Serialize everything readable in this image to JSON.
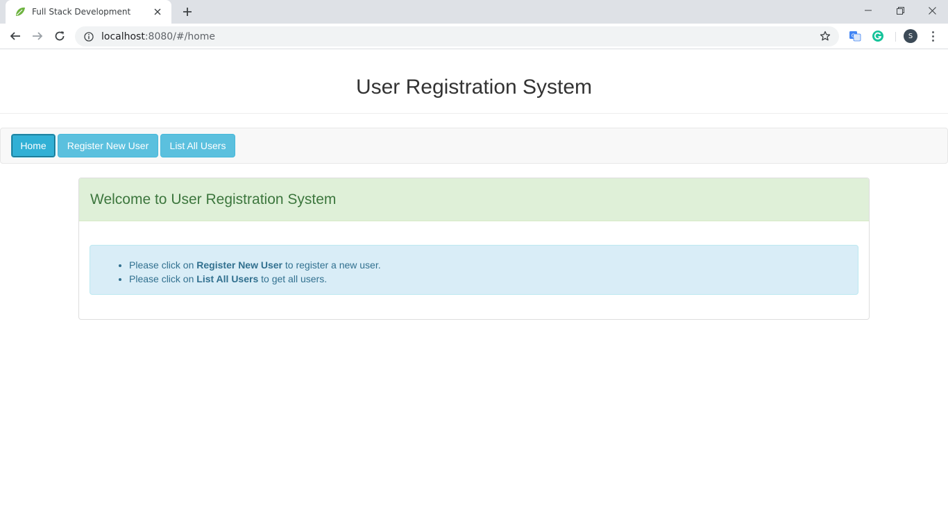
{
  "browser": {
    "tab_title": "Full Stack Development",
    "url_host": "localhost",
    "url_rest": ":8080/#/home",
    "avatar_initial": "S"
  },
  "page": {
    "title": "User Registration System",
    "nav": {
      "home": "Home",
      "register": "Register New User",
      "list": "List All Users"
    },
    "panel": {
      "heading": "Welcome to User Registration System",
      "items": [
        {
          "prefix": "Please click on ",
          "bold": "Register New User",
          "suffix": " to register a new user."
        },
        {
          "prefix": "Please click on ",
          "bold": "List All Users",
          "suffix": " to get all users."
        }
      ]
    }
  },
  "colors": {
    "info_button": "#5bc0de",
    "success_heading_bg": "#dff0d8",
    "success_heading_text": "#3c763d",
    "info_alert_bg": "#d9edf7",
    "info_alert_text": "#31708f"
  }
}
